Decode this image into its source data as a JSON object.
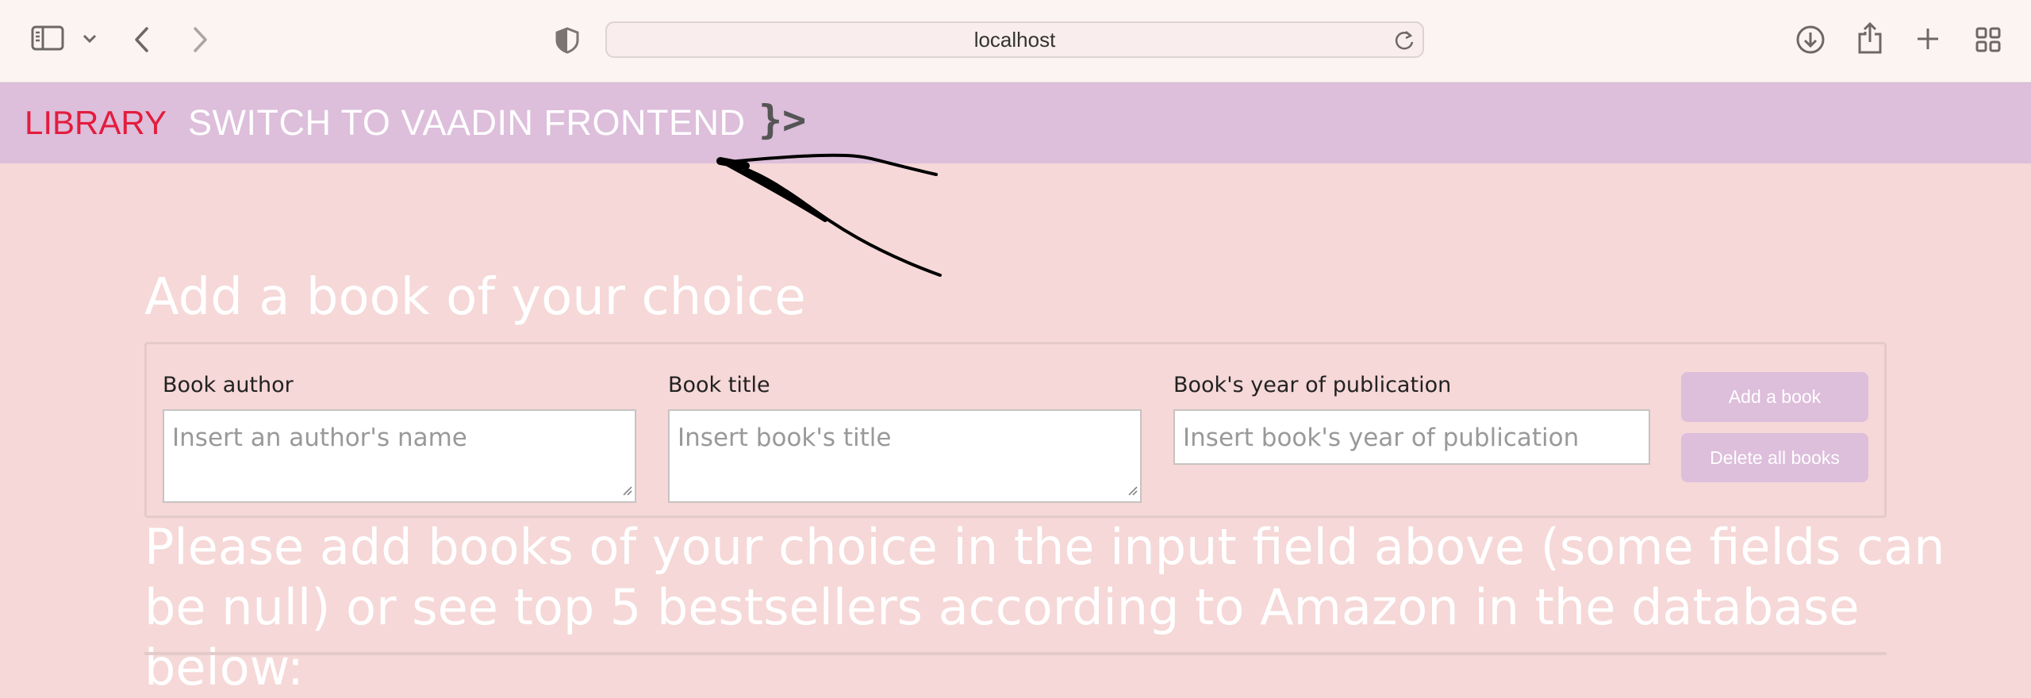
{
  "browser": {
    "url": "localhost",
    "icons": [
      "sidebar-icon",
      "chevron-down-icon",
      "back-icon",
      "forward-icon",
      "shield-icon",
      "reload-icon",
      "download-icon",
      "share-icon",
      "new-tab-icon",
      "tab-overview-icon"
    ]
  },
  "header": {
    "brand": "LIBRARY",
    "switch_link": "SWITCH TO VAADIN FRONTEND",
    "logo_text": "}>",
    "brand_color": "#e31c3d",
    "bar_color": "#ddbedb"
  },
  "form": {
    "heading": "Add a book of your choice",
    "author": {
      "label": "Book author",
      "placeholder": "Insert an author's name"
    },
    "title": {
      "label": "Book title",
      "placeholder": "Insert book's title"
    },
    "year": {
      "label": "Book's year of publication",
      "placeholder": "Insert book's year of publication"
    },
    "add_button": "Add a book",
    "delete_button": "Delete all books"
  },
  "note": "Please add books of your choice in the input field above (some fields can be null) or see top 5 bestsellers according to Amazon in the database below:",
  "colors": {
    "background": "#f5d8d7",
    "accent": "#ddbedb"
  }
}
